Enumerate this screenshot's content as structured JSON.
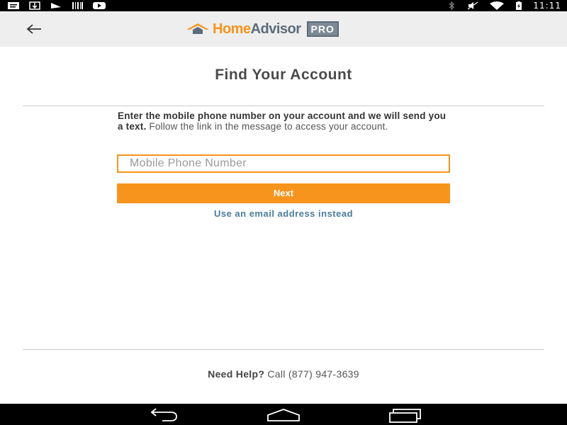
{
  "status_bar": {
    "time": "11:11",
    "left_icons": [
      "message-icon",
      "download-icon",
      "mail-icon",
      "barcode-icon",
      "youtube-icon"
    ],
    "right_icons": [
      "bluetooth-icon",
      "mute-icon",
      "wifi-icon",
      "battery-icon"
    ]
  },
  "app_bar": {
    "back_icon": "arrow-left-icon",
    "logo": {
      "home": "Home",
      "advisor": "Advisor",
      "pro": "PRO"
    }
  },
  "main": {
    "title": "Find Your Account",
    "intro_bold": "Enter the mobile phone number on your account and we will send you a text.",
    "intro_rest": " Follow the link in the message to access your account.",
    "phone_placeholder": "Mobile Phone Number",
    "phone_value": "",
    "next_label": "Next",
    "email_link": "Use an email address instead"
  },
  "footer": {
    "help_bold": "Need Help?",
    "help_rest": " Call (877) 947-3639"
  },
  "nav_bar": {
    "back": "nav-back-icon",
    "home": "nav-home-icon",
    "recents": "nav-recents-icon"
  },
  "colors": {
    "accent": "#f7941d",
    "link": "#4a7d9a",
    "app_bar_bg": "#eeeeee"
  }
}
